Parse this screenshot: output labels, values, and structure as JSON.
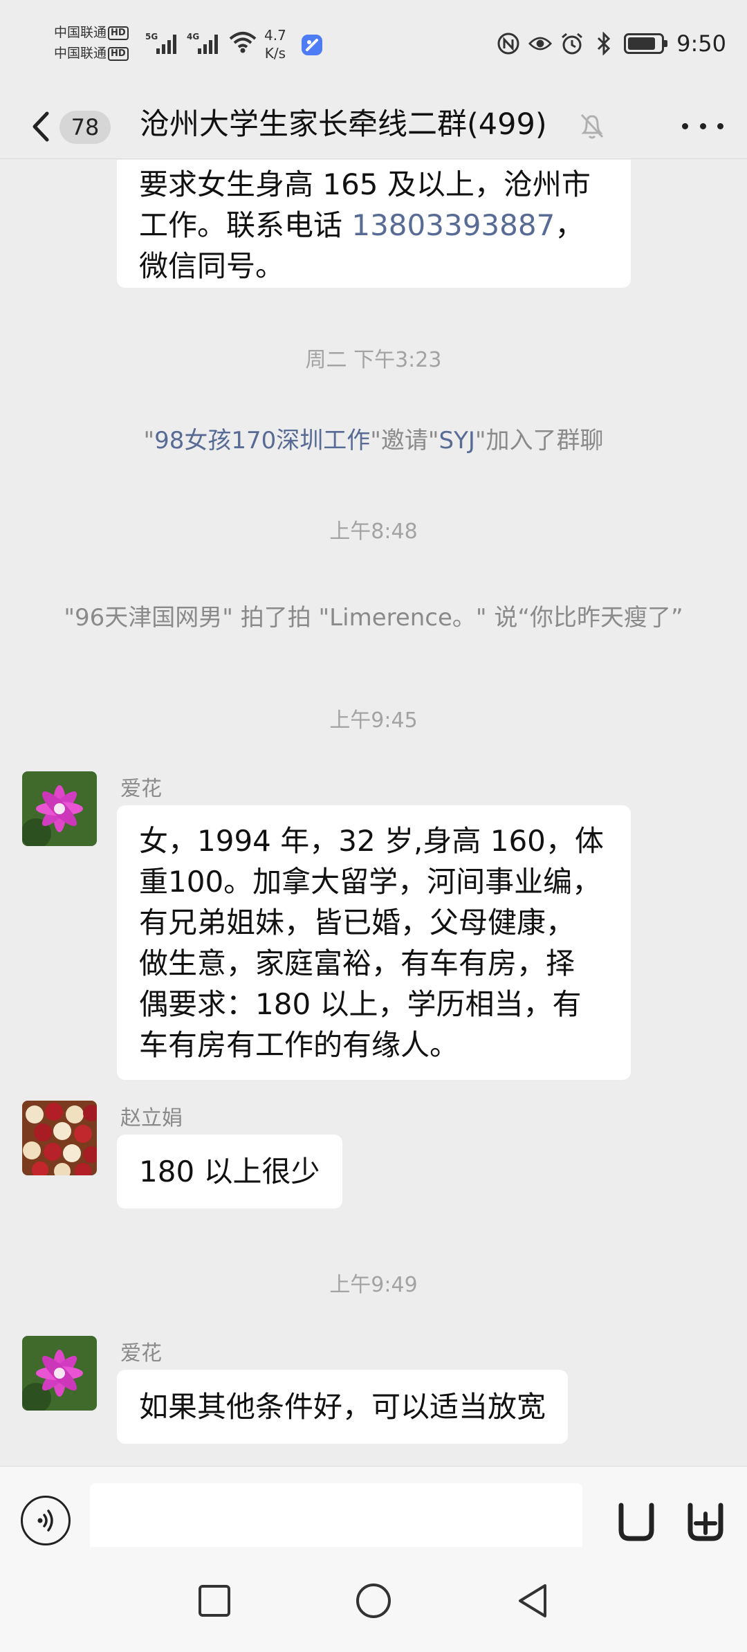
{
  "status_bar": {
    "carrier_1": "中国联通",
    "carrier_2": "中国联通",
    "hd_badge": "HD",
    "sig1_gen": "5G",
    "sig2_gen": "4G",
    "net_speed_value": "4.7",
    "net_speed_unit": "K/s",
    "time": "9:50",
    "icons": [
      "nfc-icon",
      "eye-icon",
      "alarm-icon",
      "bluetooth-icon",
      "battery-icon"
    ]
  },
  "header": {
    "unread_count": "78",
    "title": "沧州大学生家长牵线二群(499)",
    "muted": true
  },
  "messages": {
    "m0": {
      "line1": "要求女生身高 165 及以上，沧州市",
      "line2": "工作。联系电话 ",
      "phone": "13803393887",
      "line2_tail": "，",
      "line3": "微信同号。"
    },
    "t1": "周二 下午3:23",
    "sys1": {
      "q1": "\"",
      "inviter": "98女孩170深圳工作",
      "q2": "\"邀请\"",
      "invitee": "SYJ",
      "tail": "\"加入了群聊"
    },
    "t2": "上午8:48",
    "sys2": "\"96天津国网男\" 拍了拍 \"Limerence。\" 说“你比昨天瘦了”",
    "t3": "上午9:45",
    "m1": {
      "sender": "爱花",
      "lines": [
        "女，1994 年，32 岁,身高 160，体",
        "重100。加拿大留学，河间事业编，",
        "有兄弟姐妹，皆已婚，父母健康，",
        "做生意，家庭富裕，有车有房，择",
        "偶要求：180 以上，学历相当，有",
        "车有房有工作的有缘人。"
      ]
    },
    "m2": {
      "sender": "赵立娟",
      "text": "180 以上很少"
    },
    "t4": "上午9:49",
    "m3": {
      "sender": "爱花",
      "text": "如果其他条件好，可以适当放宽"
    }
  },
  "input": {
    "value": "",
    "placeholder": ""
  },
  "colors": {
    "background": "#ededed",
    "bubble": "#ffffff",
    "link": "#576b95",
    "timestamp": "#a3a3a3"
  }
}
